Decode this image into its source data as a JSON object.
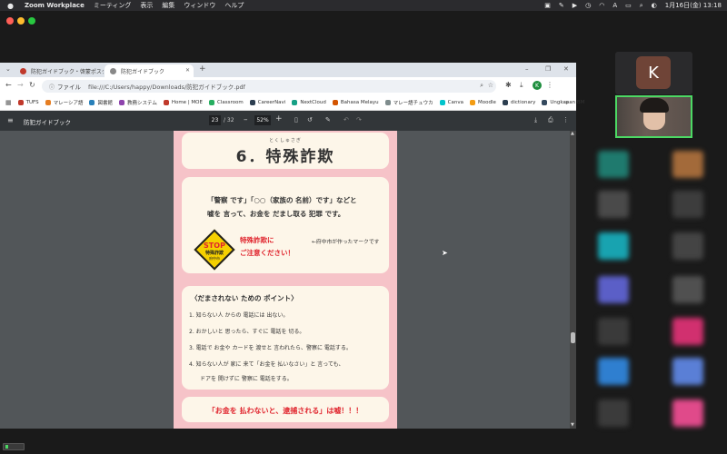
{
  "menubar": {
    "app_name": "Zoom Workplace",
    "menus": [
      "ミーティング",
      "表示",
      "編集",
      "ウィンドウ",
      "ヘルプ"
    ],
    "datetime": "1月16日(金) 13:18"
  },
  "browser": {
    "tabs": [
      {
        "label": "防犯ガイドブック・啓蒙ポスター・リー"
      },
      {
        "label": "防犯ガイドブック"
      }
    ],
    "file_label": "ファイル",
    "url": "file:///C:/Users/happy/Downloads/防犯ガイドブック.pdf",
    "profile_initial": "K",
    "bookmarks": [
      "TUFS",
      "マレーシア語",
      "図書館",
      "教務システム",
      "Home | MOE",
      "Classroom",
      "CareerNavi",
      "NextCloud",
      "Bahasa Melayu",
      "マレー語チュウカ",
      "Canva",
      "Moodle",
      "dictionary",
      "Ungkapan BM"
    ],
    "bookmark_colors": [
      "#c0392b",
      "#e67e22",
      "#2980b9",
      "#8e44ad",
      "#c0392b",
      "#27ae60",
      "#2c3e50",
      "#16a085",
      "#d35400",
      "#7f8c8d",
      "#00c4cc",
      "#f39c12",
      "#2c3e50",
      "#34495e"
    ]
  },
  "pdf": {
    "title": "防犯ガイドブック",
    "page_current": "23",
    "page_total": "/ 32",
    "zoom": "52%",
    "heading": "6．特殊詐欺",
    "heading_ruby": "とくしゅさぎ",
    "intro_line1": "「警察 です」「○○（家族の 名前）です」などと",
    "intro_line2": "嘘を 言って、お金を だまし取る 犯罪 です。",
    "stop_sign": {
      "stop": "STOP",
      "line1": "特殊詐欺",
      "line2": "府中市"
    },
    "warning_line1": "特殊詐欺に",
    "warning_line2": "ご注意ください！",
    "mark_note": "←府中市が作ったマークです",
    "points_heading": "〈だまされない ための ポイント〉",
    "points": [
      "1. 知らない人 からの 電話には 出ない。",
      "2. おかしいと 思ったら、すぐに 電話を 切る。",
      "3. 電話で お金や カードを 渡せと 言われたら、警察に 電話する。",
      "4. 知らない人が 家に 来て「お金を 払いなさい」と 言っても、",
      "ドアを 開けずに 警察に 電話をする。"
    ],
    "bottom_note": "「お金を 払わないと、逮捕される」は嘘！！！"
  },
  "participants": {
    "k_initial": "K"
  },
  "colors": {
    "page_pink": "#f6c3c8",
    "card_cream": "#fdf6e9",
    "warning_red": "#e0242d",
    "stop_yellow": "#f5d000",
    "self_border": "#4cd964"
  }
}
